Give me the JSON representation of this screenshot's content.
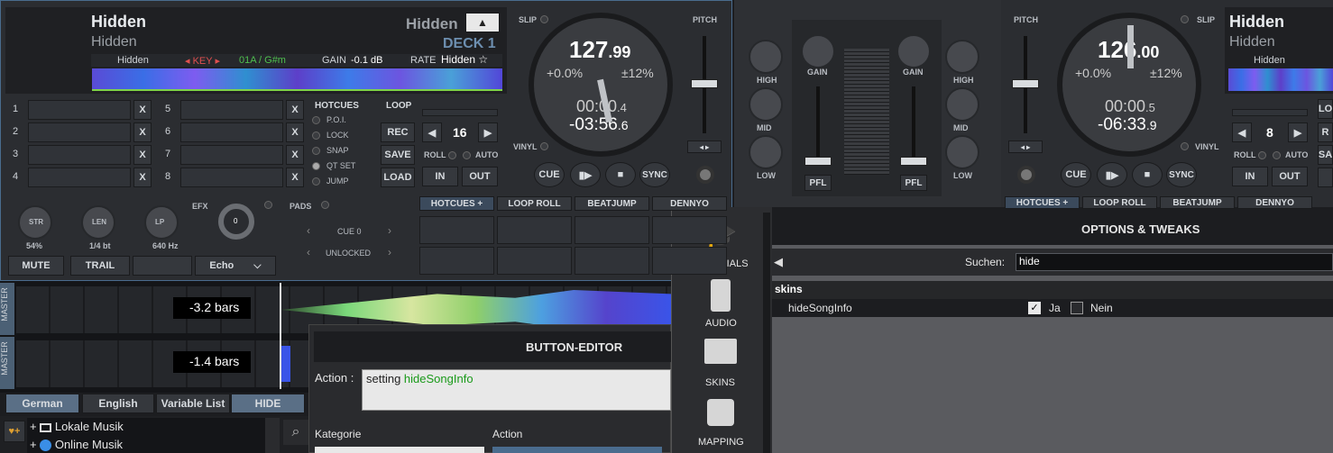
{
  "deck1": {
    "title": "Hidden",
    "artist": "Hidden",
    "title_right": "Hidden",
    "deck_label": "DECK 1",
    "eject": "▲",
    "info_left": "Hidden",
    "key_label": "KEY",
    "key_value": "01A / G#m",
    "gain_label": "GAIN",
    "gain_value": "-0.1 dB",
    "rate_label": "RATE",
    "rate_value": "Hidden ☆",
    "bpm_int": "127",
    "bpm_dec": ".99",
    "pitch_pct": "+0.0%",
    "pitch_range": "±12%",
    "time_elapsed": "00:00",
    "time_elapsed_dec": ".4",
    "time_remain": "-03:56",
    "time_remain_dec": ".6",
    "slip": "SLIP",
    "vinyl": "VINYL",
    "pitch": "PITCH",
    "cue": "CUE",
    "sync": "SYNC",
    "hotcue_numbers": [
      "1",
      "2",
      "3",
      "4",
      "5",
      "6",
      "7",
      "8"
    ],
    "x": "X",
    "hotcues_title": "HOTCUES",
    "hotcue_options": [
      "P.O.I.",
      "LOCK",
      "SNAP",
      "QT SET",
      "JUMP"
    ],
    "loop_title": "LOOP",
    "rec": "REC",
    "save": "SAVE",
    "load": "LOAD",
    "loop_size": "16",
    "roll": "ROLL",
    "auto": "AUTO",
    "in": "IN",
    "out": "OUT",
    "fx_knobs": [
      {
        "label": "STR",
        "value": "54%"
      },
      {
        "label": "LEN",
        "value": "1/4 bt"
      },
      {
        "label": "LP",
        "value": "640 Hz"
      }
    ],
    "efx": "EFX",
    "efx_knob_value": "0",
    "mute": "MUTE",
    "trail": "TRAIL",
    "echo": "Echo",
    "pads_title": "PADS",
    "pad_line1": "CUE 0",
    "pad_line2": "UNLOCKED",
    "pad_tabs": [
      "HOTCUES +",
      "LOOP ROLL",
      "BEATJUMP",
      "DENNYO"
    ]
  },
  "mixer": {
    "high": "HIGH",
    "mid": "MID",
    "low": "LOW",
    "gain": "GAIN",
    "pfl": "PFL"
  },
  "deck2": {
    "title": "Hidden",
    "artist": "Hidden",
    "info_left": "Hidden",
    "bpm_int": "126",
    "bpm_dec": ".00",
    "pitch_pct": "+0.0%",
    "pitch_range": "±12%",
    "time_elapsed": "00:00",
    "time_elapsed_dec": ".5",
    "time_remain": "-06:33",
    "time_remain_dec": ".9",
    "pitch": "PITCH",
    "slip": "SLIP",
    "vinyl": "VINYL",
    "cue": "CUE",
    "sync": "SYNC",
    "loop_size": "8",
    "roll": "ROLL",
    "auto": "AUTO",
    "in": "IN",
    "out": "OUT",
    "partial_lo": "LO",
    "partial_r": "R",
    "partial_sa": "SA",
    "pad_tabs": [
      "HOTCUES +",
      "LOOP ROLL",
      "BEATJUMP",
      "DENNYO"
    ]
  },
  "waveform": {
    "master": "MASTER",
    "bars1": "-3.2 bars",
    "bars2": "-1.4 bars"
  },
  "bottom_tabs": [
    "German",
    "English",
    "Variable List",
    "HIDE"
  ],
  "browser": {
    "items": [
      "Lokale Musik",
      "Online Musik"
    ]
  },
  "button_editor": {
    "title": "BUTTON-EDITOR",
    "action_label": "Action :",
    "action_prefix": "setting ",
    "action_value": "hideSongInfo",
    "kategorie": "Kategorie",
    "action_col": "Action"
  },
  "sidebar": {
    "items": [
      "TUTORIALS",
      "AUDIO",
      "SKINS",
      "MAPPING"
    ]
  },
  "options": {
    "title": "OPTIONS & TWEAKS",
    "search_label": "Suchen:",
    "search_value": "hide",
    "group": "skins",
    "setting_name": "hideSongInfo",
    "ja": "Ja",
    "nein": "Nein"
  },
  "colors": {
    "accent": "#3f80e0",
    "key": "#e05050",
    "green": "#4ec04e"
  }
}
